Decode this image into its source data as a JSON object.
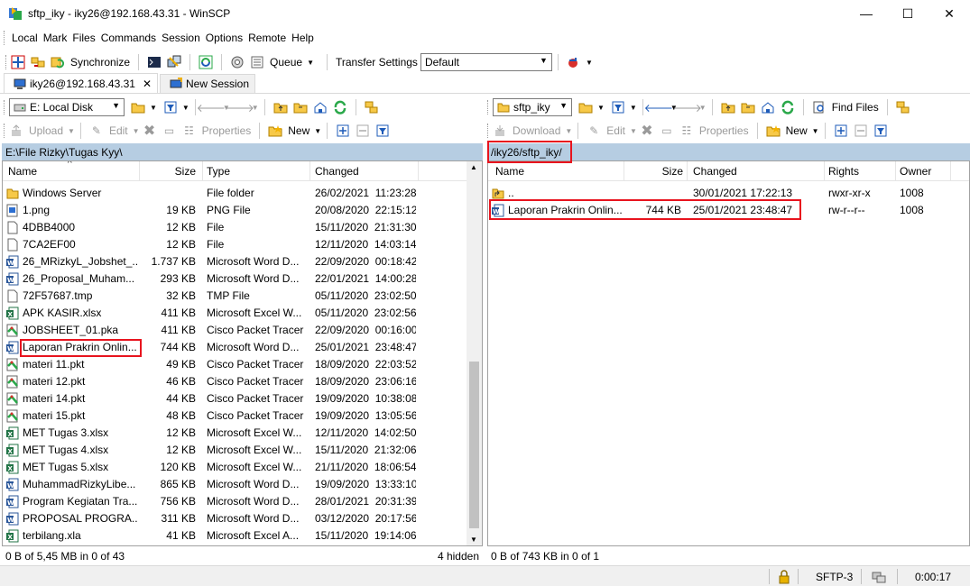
{
  "window": {
    "title": "sftp_iky - iky26@192.168.43.31 - WinSCP",
    "minimize": "—",
    "maximize": "☐",
    "close": "✕"
  },
  "menu": [
    "Local",
    "Mark",
    "Files",
    "Commands",
    "Session",
    "Options",
    "Remote",
    "Help"
  ],
  "toolbar": {
    "synchronize": "Synchronize",
    "queue": "Queue",
    "transfer_settings_label": "Transfer Settings",
    "transfer_settings_value": "Default"
  },
  "session_tabs": {
    "active": "iky26@192.168.43.31",
    "new_session": "New Session"
  },
  "local_toolbar": {
    "drive": "E: Local Disk",
    "upload": "Upload",
    "edit": "Edit",
    "properties": "Properties",
    "new": "New"
  },
  "remote_toolbar": {
    "folder": "sftp_iky",
    "find_files": "Find Files",
    "download": "Download",
    "edit": "Edit",
    "properties": "Properties",
    "new": "New"
  },
  "local": {
    "path": "E:\\File Rizky\\Tugas Kyy\\",
    "columns": [
      "Name",
      "Size",
      "Type",
      "Changed"
    ],
    "files": [
      {
        "name": "Windows Server",
        "size": "",
        "type": "File folder",
        "changed": "26/02/2021  11:23:28",
        "icon": "folder-icon"
      },
      {
        "name": "1.png",
        "size": "19 KB",
        "type": "PNG File",
        "changed": "20/08/2020  22:15:12",
        "icon": "image-file-icon"
      },
      {
        "name": "4DBB4000",
        "size": "12 KB",
        "type": "File",
        "changed": "15/11/2020  21:31:30",
        "icon": "blank-file-icon"
      },
      {
        "name": "7CA2EF00",
        "size": "12 KB",
        "type": "File",
        "changed": "12/11/2020  14:03:14",
        "icon": "blank-file-icon"
      },
      {
        "name": "26_MRizkyL_Jobshet_...",
        "size": "1.737 KB",
        "type": "Microsoft Word D...",
        "changed": "22/09/2020  00:18:42",
        "icon": "word-file-icon"
      },
      {
        "name": "26_Proposal_Muham...",
        "size": "293 KB",
        "type": "Microsoft Word D...",
        "changed": "22/01/2021  14:00:28",
        "icon": "word-file-icon"
      },
      {
        "name": "72F57687.tmp",
        "size": "32 KB",
        "type": "TMP File",
        "changed": "05/11/2020  23:02:50",
        "icon": "blank-file-icon"
      },
      {
        "name": "APK KASIR.xlsx",
        "size": "411 KB",
        "type": "Microsoft Excel W...",
        "changed": "05/11/2020  23:02:56",
        "icon": "excel-file-icon"
      },
      {
        "name": "JOBSHEET_01.pka",
        "size": "411 KB",
        "type": "Cisco Packet Tracer",
        "changed": "22/09/2020  00:16:00",
        "icon": "packet-tracer-icon"
      },
      {
        "name": "Laporan Prakrin Onlin...",
        "size": "744 KB",
        "type": "Microsoft Word D...",
        "changed": "25/01/2021  23:48:47",
        "icon": "word-file-icon"
      },
      {
        "name": "materi 11.pkt",
        "size": "49 KB",
        "type": "Cisco Packet Tracer",
        "changed": "18/09/2020  22:03:52",
        "icon": "packet-tracer-icon"
      },
      {
        "name": "materi 12.pkt",
        "size": "46 KB",
        "type": "Cisco Packet Tracer",
        "changed": "18/09/2020  23:06:16",
        "icon": "packet-tracer-icon"
      },
      {
        "name": "materi 14.pkt",
        "size": "44 KB",
        "type": "Cisco Packet Tracer",
        "changed": "19/09/2020  10:38:08",
        "icon": "packet-tracer-icon"
      },
      {
        "name": "materi 15.pkt",
        "size": "48 KB",
        "type": "Cisco Packet Tracer",
        "changed": "19/09/2020  13:05:56",
        "icon": "packet-tracer-icon"
      },
      {
        "name": "MET Tugas 3.xlsx",
        "size": "12 KB",
        "type": "Microsoft Excel W...",
        "changed": "12/11/2020  14:02:50",
        "icon": "excel-file-icon"
      },
      {
        "name": "MET Tugas 4.xlsx",
        "size": "12 KB",
        "type": "Microsoft Excel W...",
        "changed": "15/11/2020  21:32:06",
        "icon": "excel-file-icon"
      },
      {
        "name": "MET Tugas 5.xlsx",
        "size": "120 KB",
        "type": "Microsoft Excel W...",
        "changed": "21/11/2020  18:06:54",
        "icon": "excel-file-icon"
      },
      {
        "name": "MuhammadRizkyLibe...",
        "size": "865 KB",
        "type": "Microsoft Word D...",
        "changed": "19/09/2020  13:33:10",
        "icon": "word-file-icon"
      },
      {
        "name": "Program Kegiatan Tra...",
        "size": "756 KB",
        "type": "Microsoft Word D...",
        "changed": "28/01/2021  20:31:39",
        "icon": "word-file-icon"
      },
      {
        "name": "PROPOSAL PROGRA...",
        "size": "311 KB",
        "type": "Microsoft Word D...",
        "changed": "03/12/2020  20:17:56",
        "icon": "word-file-icon"
      },
      {
        "name": "terbilang.xla",
        "size": "41 KB",
        "type": "Microsoft Excel A...",
        "changed": "15/11/2020  19:14:06",
        "icon": "excel-file-icon"
      }
    ],
    "status": "0 B of 5,45 MB in 0 of 43",
    "hidden": "4 hidden"
  },
  "remote": {
    "path": "/iky26/sftp_iky/",
    "columns": [
      "Name",
      "Size",
      "Changed",
      "Rights",
      "Owner"
    ],
    "files": [
      {
        "name": "..",
        "size": "",
        "changed": "30/01/2021 17:22:13",
        "rights": "rwxr-xr-x",
        "owner": "1008",
        "icon": "parent-folder-icon"
      },
      {
        "name": "Laporan Prakrin Onlin...",
        "size": "744 KB",
        "changed": "25/01/2021 23:48:47",
        "rights": "rw-r--r--",
        "owner": "1008",
        "icon": "word-file-icon"
      }
    ],
    "status": "0 B of 743 KB in 0 of 1"
  },
  "statusbar": {
    "protocol": "SFTP-3",
    "timer": "0:00:17"
  },
  "colors": {
    "pathbar": "#b6cde2",
    "highlight": "#e8141e"
  }
}
